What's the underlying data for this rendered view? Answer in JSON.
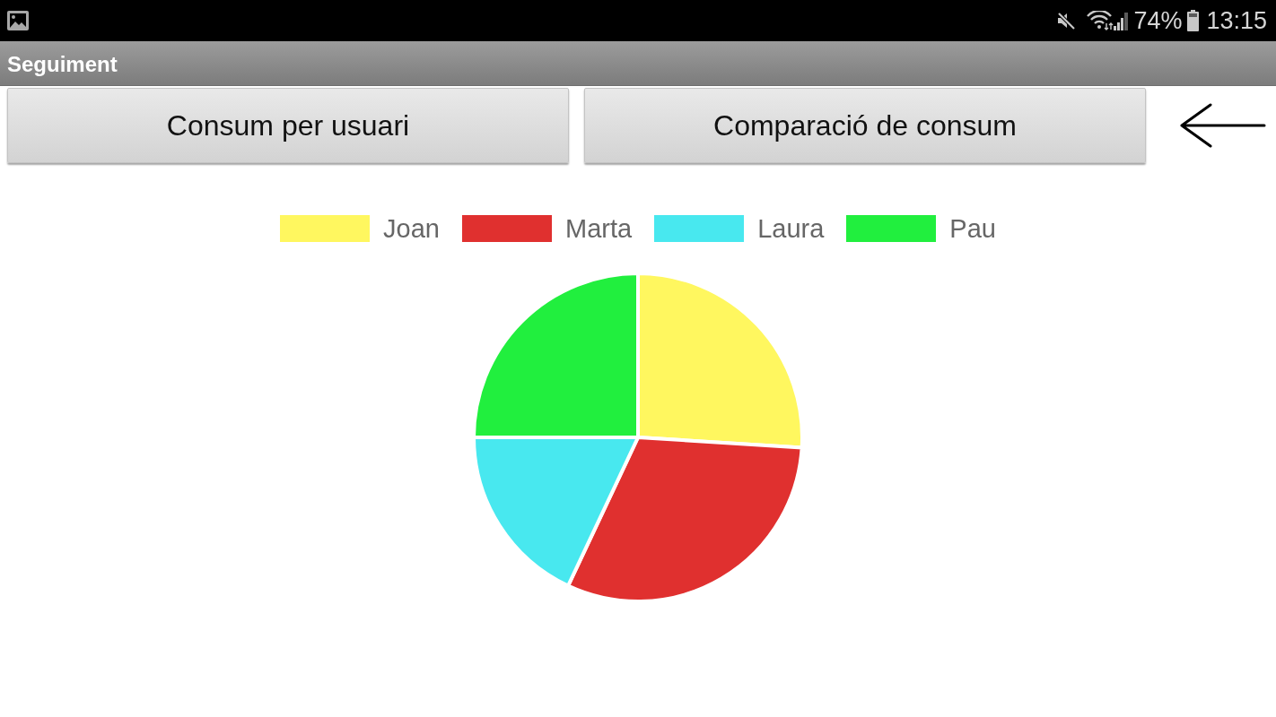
{
  "status_bar": {
    "battery": "74%",
    "time": "13:15"
  },
  "app_bar": {
    "title": "Seguiment"
  },
  "buttons": [
    {
      "label": "Consum per usuari"
    },
    {
      "label": "Comparació de consum"
    }
  ],
  "chart_data": [
    {
      "type": "pie",
      "categories": [
        "Joan",
        "Marta",
        "Laura",
        "Pau"
      ],
      "values": [
        26,
        31,
        18,
        25
      ],
      "colors": [
        "#fff75f",
        "#e0302f",
        "#48e8ef",
        "#21ef3e"
      ],
      "legend": "top"
    }
  ]
}
